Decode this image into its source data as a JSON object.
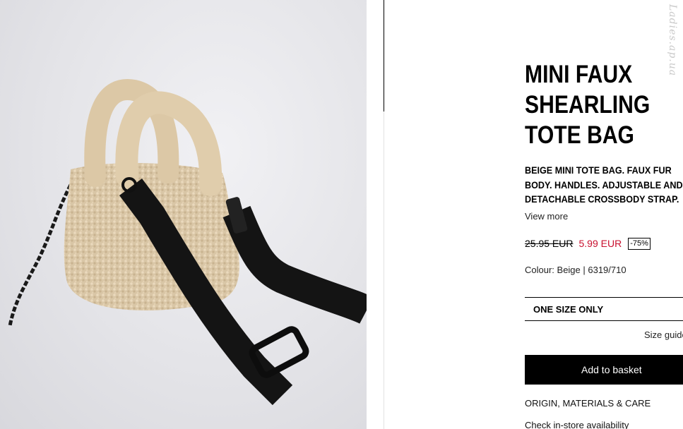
{
  "product": {
    "title": "MINI FAUX SHEARLING TOTE BAG",
    "description": "BEIGE MINI TOTE BAG. FAUX FUR BODY. HANDLES. ADJUSTABLE AND DETACHABLE CROSSBODY STRAP.",
    "view_more": "View more",
    "old_price": "25.95 EUR",
    "new_price": "5.99 EUR",
    "discount": "-75%",
    "colour": "Colour: Beige | 6319/710",
    "size": "ONE SIZE ONLY",
    "size_guide": "Size guide",
    "add_to_basket": "Add to basket",
    "origin_link": "ORIGIN, MATERIALS & CARE",
    "store_link": "Check in-store availability",
    "image_icon": "product-photo"
  },
  "watermark": "Ladies.ap.ua",
  "colors": {
    "sale_price": "#c8102e",
    "button_bg": "#000000",
    "button_text": "#ffffff"
  }
}
